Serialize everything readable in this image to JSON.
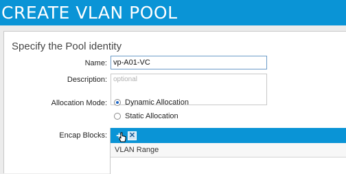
{
  "window": {
    "title": "CREATE VLAN POOL"
  },
  "section": {
    "title": "Specify the Pool identity"
  },
  "form": {
    "name_label": "Name:",
    "name_value": "vp-A01-VC",
    "description_label": "Description:",
    "description_placeholder": "optional",
    "allocation_label": "Allocation Mode:",
    "allocation_options": [
      {
        "label": "Dynamic Allocation",
        "selected": true
      },
      {
        "label": "Static Allocation",
        "selected": false
      }
    ],
    "encap_label": "Encap Blocks:"
  },
  "encap_table": {
    "toolbar": {
      "add_icon": "plus-icon",
      "delete_icon": "x-icon",
      "add_symbol": "+",
      "delete_symbol": "✕"
    },
    "columns": [
      "VLAN Range"
    ],
    "rows": []
  },
  "colors": {
    "accent": "#0a94d6",
    "title_text": "#ffffff",
    "radio_selected": "#1e66c6"
  }
}
